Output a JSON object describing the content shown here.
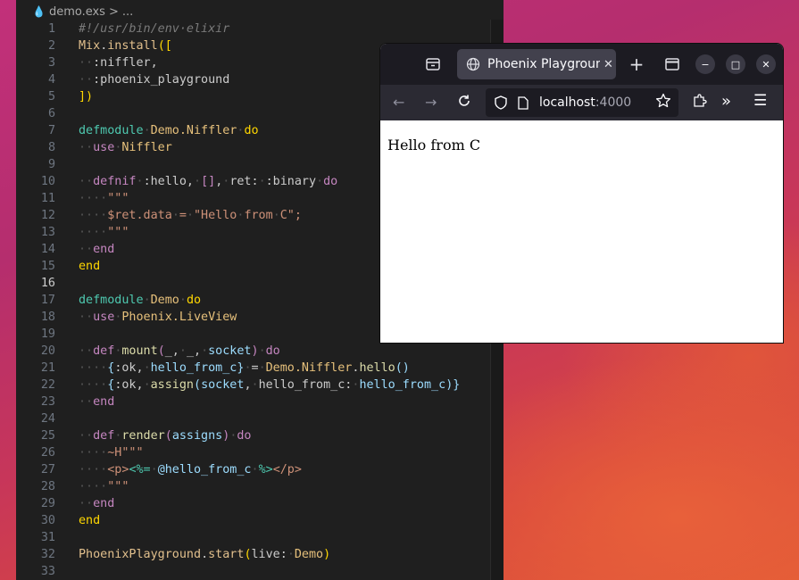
{
  "editor": {
    "breadcrumb": {
      "file": "demo.exs",
      "separator": ">",
      "more": "..."
    },
    "active_line": 16
  },
  "browser": {
    "tab_title": "Phoenix Playground",
    "url_host": "localhost",
    "url_port": ":4000",
    "content_text": "Hello from C"
  },
  "colors": {
    "editor_bg": "#1f1f1f",
    "keyword": "#c586c0",
    "module": "#4ec9b0",
    "string": "#ce9178",
    "browser_chrome": "#1c1b22"
  }
}
